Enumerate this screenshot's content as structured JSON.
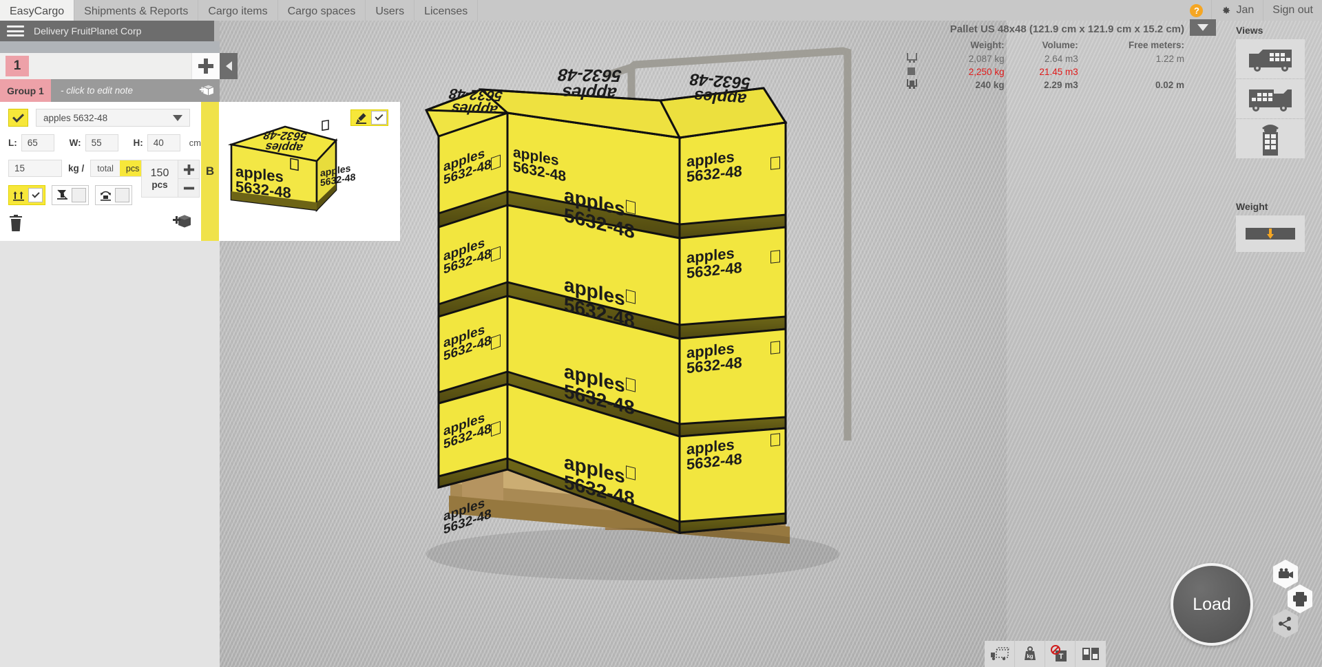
{
  "nav": {
    "tabs": [
      {
        "label": "EasyCargo",
        "active": true
      },
      {
        "label": "Shipments & Reports",
        "active": false
      },
      {
        "label": "Cargo items",
        "active": false
      },
      {
        "label": "Cargo spaces",
        "active": false
      },
      {
        "label": "Users",
        "active": false
      },
      {
        "label": "Licenses",
        "active": false
      }
    ],
    "help_label": "?",
    "user_label": "Jan",
    "signout_label": "Sign out"
  },
  "titlebar": {
    "delivery_name": "Delivery FruitPlanet Corp"
  },
  "left_panel": {
    "shipment_tab_number": "1",
    "add_button_label": "+",
    "group_label": "Group 1",
    "group_note_placeholder": "- click to edit note",
    "item": {
      "name": "apples 5632-48",
      "length_label": "L:",
      "length": "65",
      "width_label": "W:",
      "width": "55",
      "height_label": "H:",
      "height": "40",
      "dim_unit": "cm",
      "weight": "15",
      "weight_unit_label": "kg /",
      "total_label": "total",
      "pcs_label": "pcs",
      "pcs_selected": true,
      "quantity": "150",
      "quantity_unit": "pcs",
      "stepper_plus": "+",
      "stepper_minus": "−",
      "stackable_on": true,
      "tilt_on": false,
      "rotate_on": false
    },
    "strip_letter": "B"
  },
  "stats": {
    "pallet_title": "Pallet US 48x48 (121.9 cm x 121.9 cm x 15.2 cm)",
    "headers": [
      "Weight:",
      "Volume:",
      "Free meters:"
    ],
    "rows": [
      {
        "icon": "cargo-space-icon",
        "weight": "2,087 kg",
        "volume": "2.64 m3",
        "free": "1.22 m",
        "highlight": false
      },
      {
        "icon": "cargo-item-icon",
        "weight": "2,250 kg",
        "volume": "21.45 m3",
        "free": "",
        "highlight": true
      },
      {
        "icon": "loaded-icon",
        "weight": "240 kg",
        "volume": "2.29 m3",
        "free": "0.02 m",
        "highlight": false
      }
    ]
  },
  "sidebar": {
    "views_title": "Views",
    "views": [
      {
        "name": "truck-rear-view",
        "label": "Truck rear view"
      },
      {
        "name": "truck-side-view",
        "label": "Truck side view"
      },
      {
        "name": "truck-top-view",
        "label": "Truck top view"
      }
    ],
    "weight_title": "Weight",
    "weight_view_label": "Axle load view"
  },
  "actions": {
    "load_label": "Load",
    "video_label": "Animation",
    "print_label": "Print",
    "share_label": "Share"
  },
  "bottom_toolbar": [
    {
      "name": "show-cargo-space-icon",
      "label": "Cargo space outline"
    },
    {
      "name": "show-weights-icon",
      "label": "Show weights"
    },
    {
      "name": "hide-labels-icon",
      "label": "Hide labels"
    },
    {
      "name": "split-view-icon",
      "label": "Split view"
    }
  ],
  "colors": {
    "accent_yellow": "#f7e73a",
    "group_pink": "#eda1a8",
    "warning_red": "#e01b1b",
    "help_orange": "#f5a623",
    "box_yellow": "#f2e63f",
    "box_band": "#6d6416"
  },
  "scene": {
    "box_label_line1": "apples",
    "box_label_line2": "5632-48"
  }
}
